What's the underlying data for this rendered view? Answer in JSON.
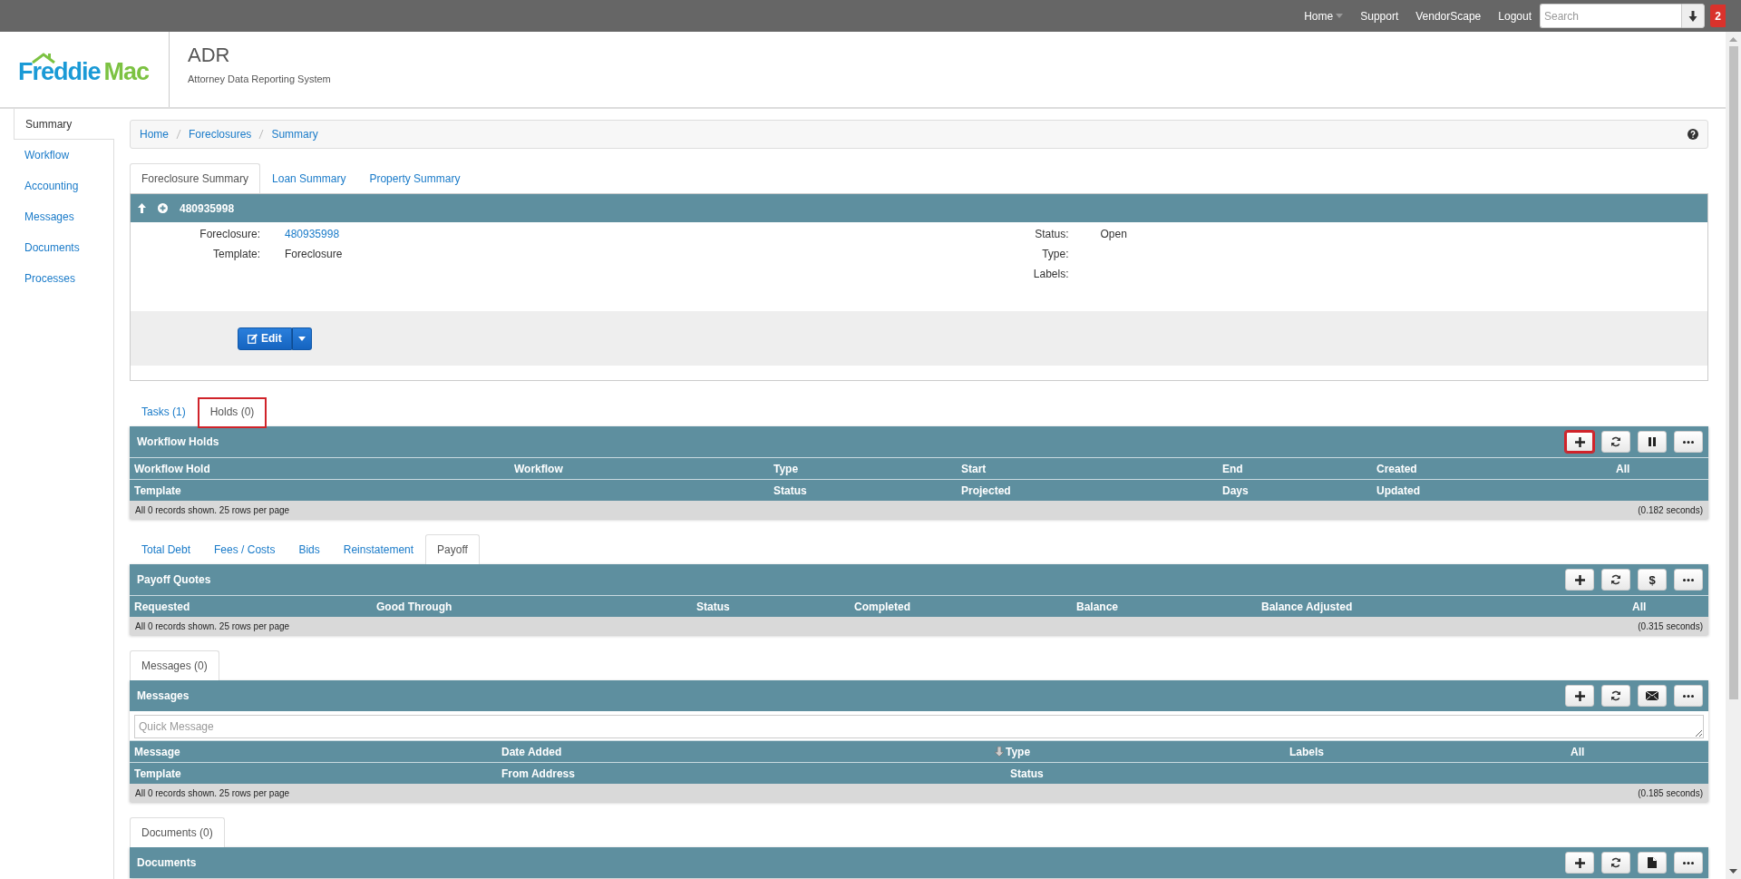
{
  "topbar": {
    "links": [
      {
        "label": "Home",
        "dropdown": true
      },
      {
        "label": "Support",
        "dropdown": false
      },
      {
        "label": "VendorScape",
        "dropdown": false
      },
      {
        "label": "Logout",
        "dropdown": false
      }
    ],
    "search": {
      "placeholder": "Search"
    },
    "notification_count": "2"
  },
  "header": {
    "logo": {
      "part_1": "Freddie",
      "part_2": "Mac"
    },
    "title": "ADR",
    "subtitle": "Attorney Data Reporting System"
  },
  "sidebar": {
    "items": [
      {
        "label": "Summary",
        "selected": true
      },
      {
        "label": "Workflow",
        "selected": false
      },
      {
        "label": "Accounting",
        "selected": false
      },
      {
        "label": "Messages",
        "selected": false
      },
      {
        "label": "Documents",
        "selected": false
      },
      {
        "label": "Processes",
        "selected": false
      }
    ]
  },
  "breadcrumb": [
    "Home",
    "Foreclosures",
    "Summary"
  ],
  "record_tabs": [
    {
      "label": "Foreclosure Summary",
      "selected": true
    },
    {
      "label": "Loan Summary",
      "selected": false
    },
    {
      "label": "Property Summary",
      "selected": false
    }
  ],
  "record": {
    "id": "480935998",
    "fields_left": [
      {
        "label": "Foreclosure:",
        "value": "480935998",
        "link": true
      },
      {
        "label": "Template:",
        "value": "Foreclosure",
        "link": false
      }
    ],
    "fields_right": [
      {
        "label": "Status:",
        "value": "Open",
        "link": false
      },
      {
        "label": "Type:"
      },
      {
        "label": "Labels:"
      }
    ],
    "edit_button": "Edit"
  },
  "sections": [
    {
      "tabs": [
        {
          "label": "Tasks (1)",
          "selected": false,
          "highlighted": false
        },
        {
          "label": "Holds (0)",
          "selected": true,
          "highlighted": true
        }
      ],
      "title": "Workflow Holds",
      "buttons": [
        {
          "kind": "icon",
          "highlighted": true
        },
        {
          "kind": "icon",
          "highlighted": false
        },
        {
          "kind": "icon",
          "highlighted": false
        },
        {
          "kind": "icon",
          "highlighted": false
        }
      ],
      "columns": [
        {
          "top": "Workflow Hold",
          "bottom": "Template"
        },
        {
          "top": "Workflow"
        },
        {
          "top": "Type",
          "bottom": "Status"
        },
        {
          "top": "Start",
          "bottom": "Projected"
        },
        {
          "top": "End",
          "bottom": "Days"
        },
        {
          "top": "Created",
          "bottom": "Updated"
        },
        {
          "top": "All"
        }
      ],
      "footer_left": "All 0 records shown. 25 rows per page",
      "footer_right": "(0.182 seconds)"
    },
    {
      "tabs": [
        {
          "label": "Total Debt",
          "selected": false,
          "highlighted": false
        },
        {
          "label": "Fees / Costs",
          "selected": false,
          "highlighted": false
        },
        {
          "label": "Bids",
          "selected": false,
          "highlighted": false
        },
        {
          "label": "Reinstatement",
          "selected": false,
          "highlighted": false
        },
        {
          "label": "Payoff",
          "selected": true,
          "highlighted": false
        }
      ],
      "title": "Payoff Quotes",
      "buttons": [
        {
          "kind": "icon",
          "highlighted": false
        },
        {
          "kind": "icon",
          "highlighted": false
        },
        {
          "kind": "glyph",
          "glyph": "$",
          "highlighted": false
        },
        {
          "kind": "icon",
          "highlighted": false
        }
      ],
      "columns": [
        {
          "top": "Requested"
        },
        {
          "top": "Good Through"
        },
        {
          "top": "Status"
        },
        {
          "top": "Completed"
        },
        {
          "top": "Balance"
        },
        {
          "top": "Balance Adjusted"
        },
        {
          "top": "All"
        }
      ],
      "footer_left": "All 0 records shown. 25 rows per page",
      "footer_right": "(0.315 seconds)"
    },
    {
      "tabs": [
        {
          "label": "Messages (0)",
          "selected": true,
          "highlighted": false
        }
      ],
      "title": "Messages",
      "buttons": [
        {
          "kind": "icon",
          "highlighted": false
        },
        {
          "kind": "icon",
          "highlighted": false
        },
        {
          "kind": "icon",
          "highlighted": false
        },
        {
          "kind": "icon",
          "highlighted": false
        }
      ],
      "quick_message": {
        "placeholder": "Quick Message"
      },
      "columns": [
        {
          "top": "Message",
          "bottom": "Template"
        },
        {
          "top": "Date Added",
          "bottom": "From Address"
        },
        {
          "top": "Type",
          "bottom": "Status",
          "sorted": true
        },
        {
          "top": "Labels"
        },
        {
          "top": "All"
        }
      ],
      "footer_left": "All 0 records shown. 25 rows per page",
      "footer_right": "(0.185 seconds)"
    },
    {
      "tabs": [
        {
          "label": "Documents (0)",
          "selected": true,
          "highlighted": false
        }
      ],
      "title": "Documents",
      "buttons": [
        {
          "kind": "icon",
          "highlighted": false
        },
        {
          "kind": "icon",
          "highlighted": false
        },
        {
          "kind": "icon",
          "highlighted": false
        },
        {
          "kind": "icon",
          "highlighted": false
        }
      ]
    }
  ]
}
